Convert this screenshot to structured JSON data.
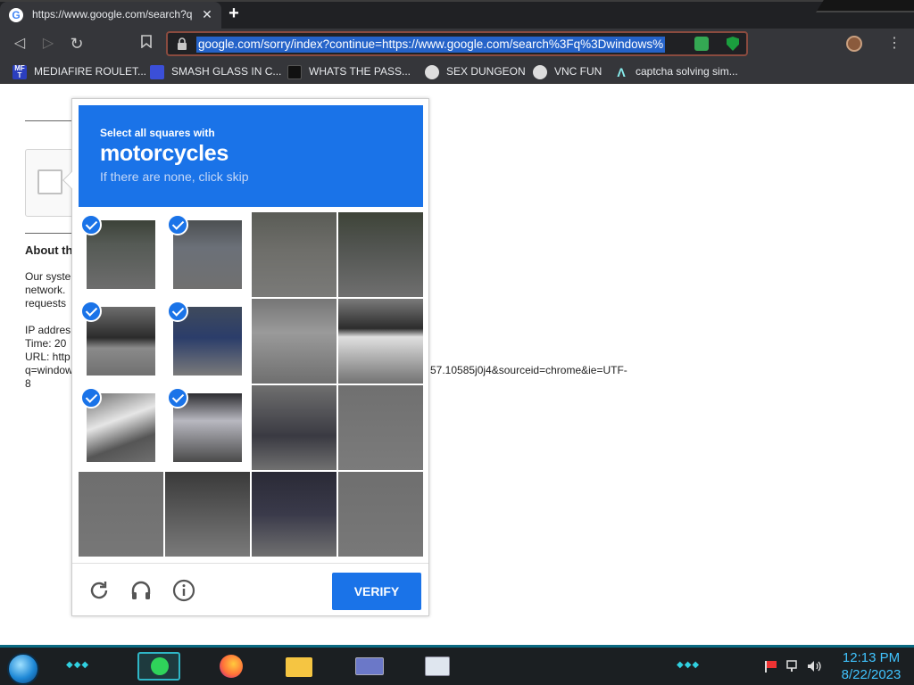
{
  "browser": {
    "tab_title": "https://www.google.com/search?q",
    "tab_close": "✕",
    "new_tab": "+",
    "favicon_letter": "G",
    "url": "google.com/sorry/index?continue=https://www.google.com/search%3Fq%3Dwindows%",
    "nav": {
      "back": "◁",
      "forward": "▷",
      "reload": "↻",
      "bookmark": "🔖",
      "menu": "⋮"
    }
  },
  "bookmarks": [
    {
      "label": "MEDIAFIRE ROULET...",
      "icon": "mediafire-icon",
      "color": "#2b3fbf"
    },
    {
      "label": "SMASH GLASS IN C...",
      "icon": "smash-icon",
      "color": "#3b4fd8"
    },
    {
      "label": "WHATS THE PASS...",
      "icon": "password-icon",
      "color": "#111111"
    },
    {
      "label": "SEX DUNGEON",
      "icon": "dungeon-icon",
      "color": "#dddddd"
    },
    {
      "label": "VNC FUN",
      "icon": "vnc-icon",
      "color": "#dddddd"
    },
    {
      "label": "captcha solving sim...",
      "icon": "lambda-icon",
      "color": "#35363a"
    }
  ],
  "page": {
    "about_heading": "About th",
    "para_lines": [
      "Our syste",
      "network.",
      "requests"
    ],
    "ip_line": "IP addres",
    "time_line": "Time: 20",
    "url_line": "URL: http",
    "q_line": "q=window",
    "tail_line": "57.10585j0j4&sourceid=chrome&ie=UTF-",
    "eight_line": "8"
  },
  "captcha": {
    "instruction": "Select all squares with",
    "target": "motorcycles",
    "hint": "If there are none, click skip",
    "verify_label": "VERIFY",
    "selected": [
      true,
      true,
      false,
      false,
      true,
      true,
      false,
      false,
      true,
      true,
      false,
      false,
      false,
      false,
      false,
      false
    ]
  },
  "taskbar": {
    "time": "12:13 PM",
    "date": "8/22/2023"
  }
}
